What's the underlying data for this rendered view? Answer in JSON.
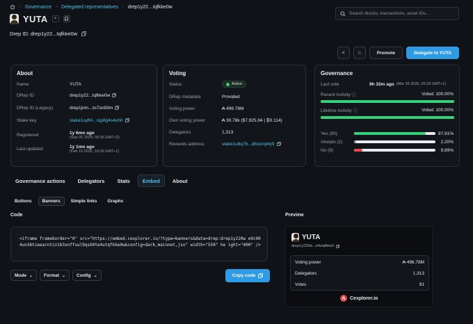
{
  "breadcrumbs": [
    "Governance",
    "Delegated representatives",
    "drep1y22…tqfkke0w"
  ],
  "search": {
    "placeholder": "Search blocks, transactions, asset IDs..."
  },
  "header": {
    "title": "YUTA",
    "drep_label": "Drep ID: drep1y22...tqfkke0w"
  },
  "actions": {
    "share": "<",
    "star": "☆",
    "promote": "Promote",
    "delegate": "Delegate to YUTA"
  },
  "about": {
    "title": "About",
    "rows": [
      {
        "k": "Name",
        "v": "YUTA"
      },
      {
        "k": "DRep ID",
        "v": "drep1y22...tqfkke0w"
      },
      {
        "k": "DRep ID (Legacy)",
        "v": "drep1jnm...zc7sn83m"
      },
      {
        "k": "Stake key",
        "v": "stake1uyft4...rqp8g4s4uh0"
      },
      {
        "k": "Registered",
        "v": "1y 6mo ago",
        "sub": "(Sep 06 2024, 09:36 GMT+2)"
      },
      {
        "k": "Last updated",
        "v": "1y 1mo ago",
        "sub": "(Feb 10 2025, 16:55 GMT+1)"
      }
    ]
  },
  "voting": {
    "title": "Voting",
    "status_label": "Status",
    "status": "Active",
    "metadata_label": "DRep metadata",
    "metadata": "Provided",
    "power_label": "Voting power",
    "power": "₳ 496.78M",
    "own_label": "Own voting power",
    "own": "₳ 30.78k ($7,925.94 | ₿0.114)",
    "delegators_label": "Delegators",
    "delegators": "1,313",
    "rewards_label": "Rewards address",
    "rewards": "stake1u8q76...d8slcrqi4y9"
  },
  "governance": {
    "title": "Governance",
    "last_vote_label": "Last vote",
    "last_vote": "9h 32m ago",
    "last_vote_sub": "(Mar 26 2026, 05:33 GMT+1)",
    "recent_label": "Recent Activity",
    "recent_value": "Voted: 100.00%",
    "recent_pct": 100,
    "lifetime_label": "Lifetime Activity",
    "lifetime_value": "Voted: 100.00%",
    "lifetime_pct": 100,
    "votes": [
      {
        "label": "Yes (80)",
        "pct_text": "87.91%",
        "pct": 87.91,
        "color": "#34d07c"
      },
      {
        "label": "Abstain (2)",
        "pct_text": "2.20%",
        "pct": 2.2,
        "color": "#9aa1a9"
      },
      {
        "label": "No (9)",
        "pct_text": "9.89%",
        "pct": 9.89,
        "color": "#e5484d"
      }
    ]
  },
  "tabs": [
    "Governance actions",
    "Delegators",
    "Stats",
    "Embed",
    "About"
  ],
  "active_tab": "Embed",
  "subtabs": [
    "Buttons",
    "Banners",
    "Simple links",
    "Graphs"
  ],
  "active_subtab": "Banners",
  "code": {
    "title": "Code",
    "text": "<iframe frameborder=\"0\" src=\"https://embed.cexplorer.io/?type=banners&data=drep:drep1y220w e9c904un36tzaearntzz163snffuul9qsk0te4utqfkke0w&config=dark,mainnet,jsx\" width=\"550\" he ight=\"400\" />"
  },
  "dropdowns": {
    "mode": "Mode",
    "format": "Format",
    "config": "Config"
  },
  "copy_button": "Copy code",
  "preview": {
    "title": "Preview",
    "name": "YUTA",
    "id": "drep1y220w...e4utqfkke0",
    "rows": [
      {
        "k": "Voting power",
        "v": "₳ 496.78M"
      },
      {
        "k": "Delegators",
        "v": "1,313"
      },
      {
        "k": "Votes",
        "v": "91"
      }
    ],
    "brand": "Cexplorer.io"
  },
  "colors": {
    "accent": "#4fc3e8",
    "primary_button": "#2f9be4",
    "green": "#34d07c",
    "red": "#e5484d"
  }
}
